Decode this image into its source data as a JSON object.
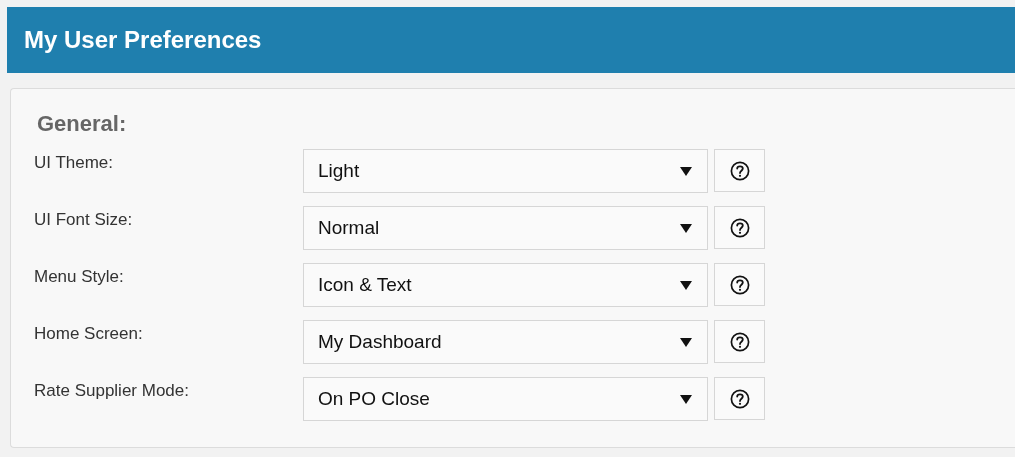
{
  "header": {
    "title": "My User Preferences"
  },
  "section": {
    "title": "General:",
    "settings": [
      {
        "label": "UI Theme:",
        "value": "Light"
      },
      {
        "label": "UI Font Size:",
        "value": "Normal"
      },
      {
        "label": "Menu Style:",
        "value": "Icon & Text"
      },
      {
        "label": "Home Screen:",
        "value": "My Dashboard"
      },
      {
        "label": "Rate Supplier Mode:",
        "value": "On PO Close"
      }
    ]
  }
}
